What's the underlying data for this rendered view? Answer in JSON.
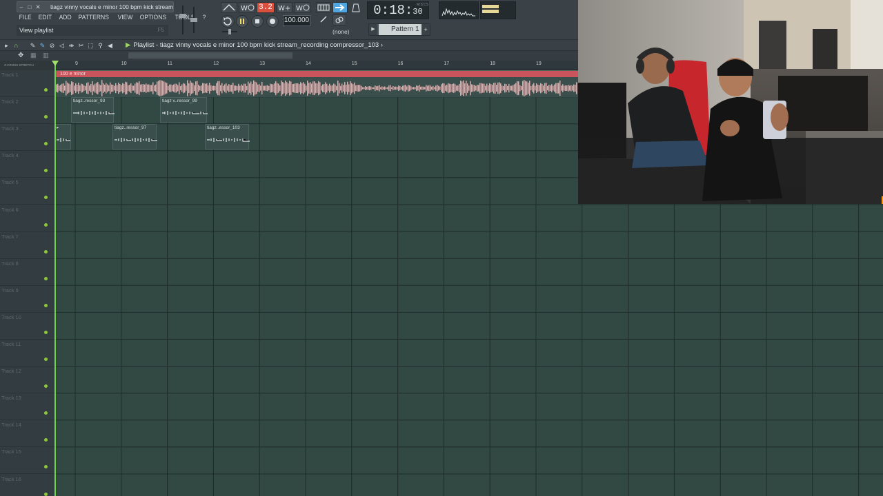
{
  "window": {
    "title": "tiagz vinny vocals e minor 100 bpm kick stream.",
    "minimize": "–",
    "restore": "□",
    "close": "✕"
  },
  "menu": [
    "FILE",
    "EDIT",
    "ADD",
    "PATTERNS",
    "VIEW",
    "OPTIONS",
    "TOOLS",
    "?"
  ],
  "hint": {
    "text": "View playlist",
    "key": "F5"
  },
  "toolbar": {
    "buttons": [
      "3.2"
    ],
    "tempo": "100.000",
    "pattern_none": "(none)"
  },
  "time": {
    "main": "0:18:",
    "ms": "30",
    "unit": "M:S:CS"
  },
  "pattern": {
    "label": "Pattern 1",
    "prev": "▶",
    "next": "+"
  },
  "playlist": {
    "title": "Playlist - tiagz vinny vocals e minor 100 bpm kick stream_recording compressor_103",
    "play_icon": "▶",
    "chevron": "›",
    "left_labels": "Z-CROSS  STRETCH"
  },
  "ruler": [
    "9",
    "10",
    "11",
    "12",
    "13",
    "14",
    "15",
    "16",
    "17",
    "18",
    "19"
  ],
  "tracks": [
    "Track 1",
    "Track 2",
    "Track 3",
    "Track 4",
    "Track 5",
    "Track 6",
    "Track 7",
    "Track 8",
    "Track 9",
    "Track 10",
    "Track 11",
    "Track 12",
    "Track 13",
    "Track 14",
    "Track 15",
    "Track 16"
  ],
  "clips": {
    "main": "100 e minor",
    "t2a": "tiagz..ressor_93",
    "t2b": "tiagz v..ressor_99",
    "t3a": "▸",
    "t3b": "tiagz..ressor_97",
    "t3c": "tiagz..essor_103"
  }
}
